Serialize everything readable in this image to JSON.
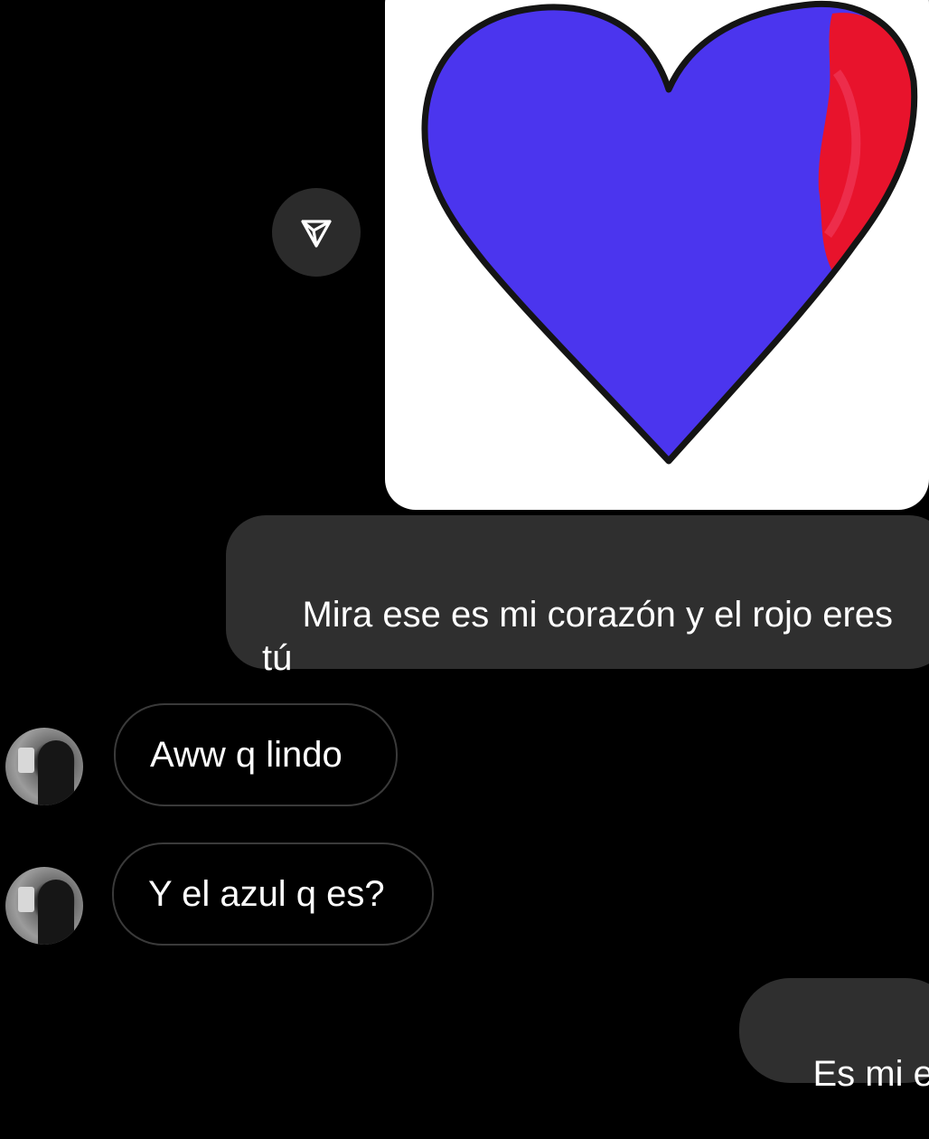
{
  "image_message": {
    "description_icon": "heart-drawing",
    "heart_main_color": "#4b35ee",
    "heart_accent_color": "#e8132c",
    "outline_color": "#141414"
  },
  "share_icon": "send-arrow-icon",
  "messages": [
    {
      "from": "me",
      "text": "Mira ese es mi corazón y el rojo eres tú"
    },
    {
      "from": "them",
      "text": "Aww q lindo"
    },
    {
      "from": "them",
      "text": "Y el azul q es?"
    },
    {
      "from": "me",
      "text": "Es mi ex"
    }
  ],
  "colors": {
    "background": "#000000",
    "outgoing_bubble": "#2f2f2f",
    "incoming_border": "#3a3a3a",
    "text": "#ffffff"
  }
}
